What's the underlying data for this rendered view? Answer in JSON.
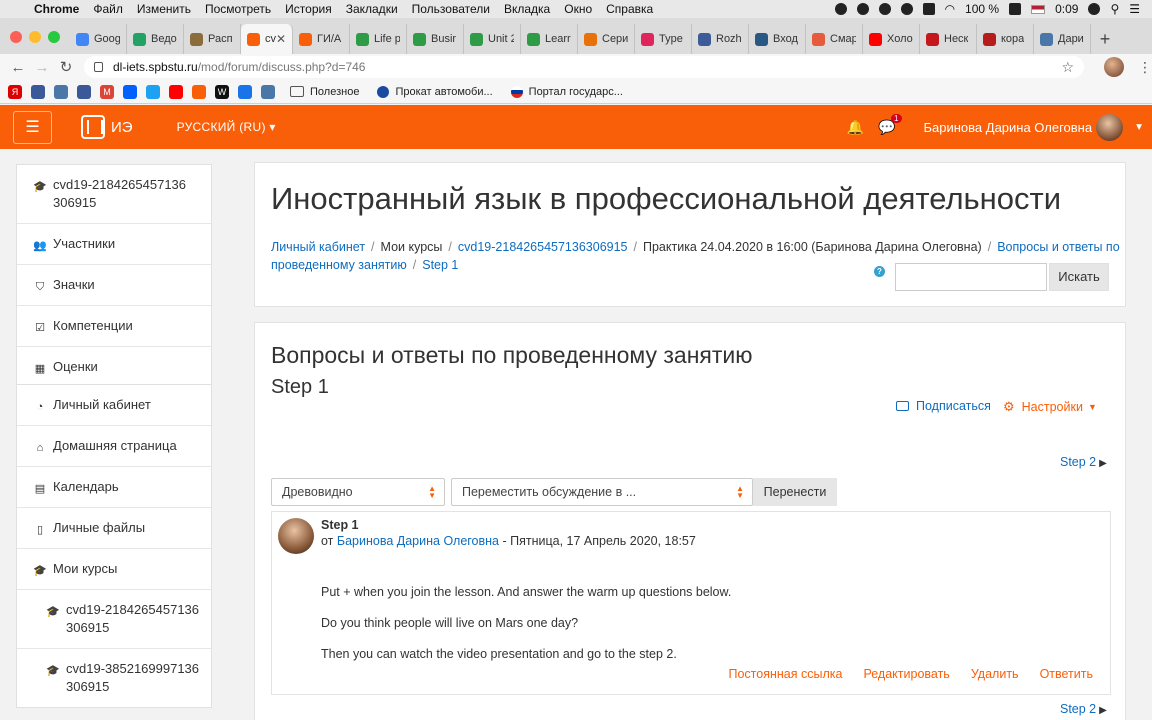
{
  "macos": {
    "app_name": "Chrome",
    "menu": [
      "Файл",
      "Изменить",
      "Посмотреть",
      "История",
      "Закладки",
      "Пользователи",
      "Вкладка",
      "Окно",
      "Справка"
    ],
    "battery": "100 %",
    "time": "0:09"
  },
  "browser": {
    "tabs": [
      {
        "label": "Goog",
        "color": "#4285f4"
      },
      {
        "label": "Ведо",
        "color": "#21a366"
      },
      {
        "label": "Расп",
        "color": "#8a6d3b"
      },
      {
        "label": "cvd",
        "color": "#f95f08",
        "active": true
      },
      {
        "label": "ГИ/А",
        "color": "#f95f08"
      },
      {
        "label": "Life p",
        "color": "#2e9b46"
      },
      {
        "label": "Busir",
        "color": "#2e9b46"
      },
      {
        "label": "Unit 2",
        "color": "#2e9b46"
      },
      {
        "label": "Learr",
        "color": "#2e9b46"
      },
      {
        "label": "Сери",
        "color": "#e8710a"
      },
      {
        "label": "Type",
        "color": "#e0245e"
      },
      {
        "label": "Rozh",
        "color": "#3d5a99"
      },
      {
        "label": "Вход",
        "color": "#2a5885"
      },
      {
        "label": "Смар",
        "color": "#e55b3c"
      },
      {
        "label": "Холо",
        "color": "#ff0000"
      },
      {
        "label": "Неск",
        "color": "#c4161c"
      },
      {
        "label": "кора",
        "color": "#b71c1c"
      },
      {
        "label": "Дари",
        "color": "#4a76a8"
      }
    ],
    "close_glyph": "✕",
    "new_tab_glyph": "+",
    "url_host": "dl-iets.spbstu.ru",
    "url_path": "/mod/forum/discuss.php?d=746",
    "bookmarks": [
      {
        "label": "Полезное",
        "kind": "folder"
      },
      {
        "label": "Прокат автомоби...",
        "kind": "site"
      },
      {
        "label": "Портал государс...",
        "kind": "site"
      }
    ],
    "bookmark_icon_colors": [
      "#d00",
      "#3b5998",
      "#4a76a8",
      "#3b5998",
      "#db4437",
      "#0061ff",
      "#1da1f2",
      "#ff0000",
      "#f95f08",
      "#111",
      "#1a73e8",
      "#4a76a8"
    ],
    "bookmark_letters": [
      "Я",
      "",
      "",
      "",
      "M",
      "",
      "",
      "",
      "",
      "W",
      "",
      ""
    ]
  },
  "navbar": {
    "brand": "ИЭ",
    "language": "РУССКИЙ (RU)",
    "message_count": "1",
    "user_name": "Баринова Дарина Олеговна",
    "accent": "#f95f08"
  },
  "drawer": {
    "course_group": [
      {
        "label": "cvd19-2184265457136306915",
        "icon": "graduation-cap-icon",
        "glyph": "🎓"
      },
      {
        "label": "Участники",
        "icon": "users-icon",
        "glyph": "👥"
      },
      {
        "label": "Значки",
        "icon": "shield-icon",
        "glyph": "⛉"
      },
      {
        "label": "Компетенции",
        "icon": "checkbox-icon",
        "glyph": "☑"
      },
      {
        "label": "Оценки",
        "icon": "table-icon",
        "glyph": "▦"
      }
    ],
    "site_group": [
      {
        "label": "Личный кабинет",
        "icon": "dashboard-icon",
        "glyph": "◔"
      },
      {
        "label": "Домашняя страница",
        "icon": "home-icon",
        "glyph": "⌂"
      },
      {
        "label": "Календарь",
        "icon": "calendar-icon",
        "glyph": "▤"
      },
      {
        "label": "Личные файлы",
        "icon": "file-icon",
        "glyph": "▯"
      },
      {
        "label": "Мои курсы",
        "icon": "graduation-cap-icon",
        "glyph": "🎓"
      },
      {
        "label": "cvd19-2184265457136306915",
        "icon": "graduation-cap-icon",
        "glyph": "🎓",
        "indent": true
      },
      {
        "label": "cvd19-3852169997136306915",
        "icon": "graduation-cap-icon",
        "glyph": "🎓",
        "indent": true
      }
    ]
  },
  "header": {
    "title": "Иностранный язык в профессиональной деятельности",
    "breadcrumb": [
      {
        "label": "Личный кабинет",
        "link": true
      },
      {
        "label": "Мои курсы",
        "link": false
      },
      {
        "label": "cvd19-2184265457136306915",
        "link": true
      },
      {
        "label": "Практика 24.04.2020 в 16:00 (Баринова Дарина Олеговна)",
        "link": false
      },
      {
        "label": "Вопросы и ответы по проведенному занятию",
        "link": true
      },
      {
        "label": "Step 1",
        "link": true
      }
    ],
    "search_button": "Искать",
    "search_value": ""
  },
  "forum": {
    "title": "Вопросы и ответы по проведенному занятию",
    "discussion": "Step 1",
    "subscribe": "Подписаться",
    "settings": "Настройки",
    "next_discussion": "Step 2",
    "display_mode": "Древовидно",
    "move_placeholder": "Переместить обсуждение в ...",
    "move_button": "Перенести"
  },
  "post": {
    "subject": "Step 1",
    "by_prefix": "от",
    "author": "Баринова Дарина Олеговна",
    "date": "- Пятница, 17 Апрель 2020, 18:57",
    "body": [
      "Put + when you join the lesson. And answer the warm up questions below.",
      "Do you think people will live on Mars one day?",
      "Then you can watch the video presentation and go to the step 2."
    ],
    "actions": [
      "Постоянная ссылка",
      "Редактировать",
      "Удалить",
      "Ответить"
    ]
  }
}
